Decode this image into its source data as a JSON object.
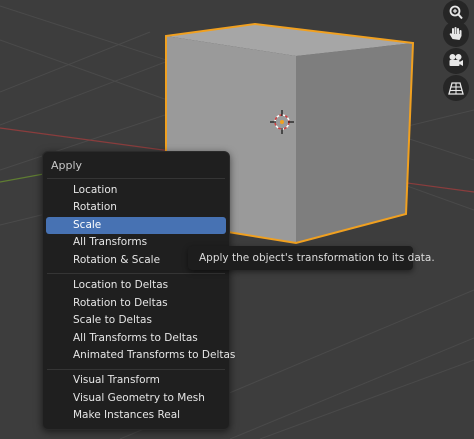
{
  "viewport": {
    "colors": {
      "background": "#3d3d3d",
      "grid_line": "#4a4a4a",
      "x_axis": "#8a3d3d",
      "y_axis": "#5f7d32",
      "cube_selection": "#f0a020"
    }
  },
  "nav_gizmos": [
    {
      "icon": "zoom-icon"
    },
    {
      "icon": "hand-icon"
    },
    {
      "icon": "camera-icon"
    },
    {
      "icon": "grid-icon"
    }
  ],
  "menu": {
    "title": "Apply",
    "groups": [
      {
        "items": [
          "Location",
          "Rotation",
          "Scale",
          "All Transforms",
          "Rotation & Scale"
        ]
      },
      {
        "items": [
          "Location to Deltas",
          "Rotation to Deltas",
          "Scale to Deltas",
          "All Transforms to Deltas",
          "Animated Transforms to Deltas"
        ]
      },
      {
        "items": [
          "Visual Transform",
          "Visual Geometry to Mesh",
          "Make Instances Real"
        ]
      }
    ],
    "active_item": "Scale",
    "accent_color": "#4772b3"
  },
  "tooltip": {
    "text": "Apply the object's transformation to its data."
  }
}
